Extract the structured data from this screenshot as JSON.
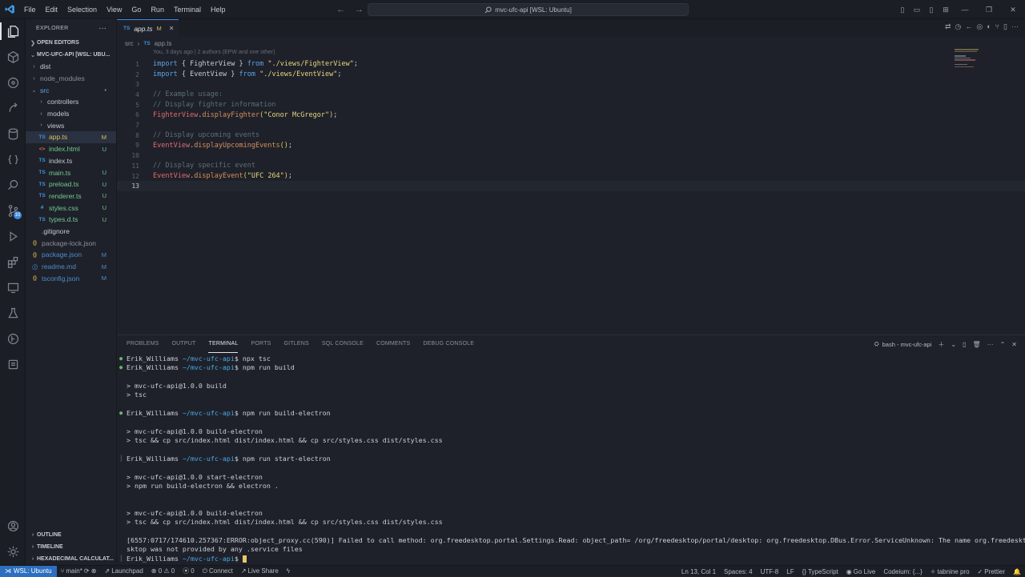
{
  "titlebar": {
    "menus": [
      "File",
      "Edit",
      "Selection",
      "View",
      "Go",
      "Run",
      "Terminal",
      "Help"
    ],
    "search_text": "mvc-ufc-api [WSL: Ubuntu]"
  },
  "sidebar": {
    "title": "EXPLORER",
    "open_editors": "OPEN EDITORS",
    "project": "MVC-UFC-API [WSL: UBU...",
    "items": [
      {
        "label": "dist",
        "type": "folder",
        "state": "closed",
        "depth": 1,
        "status": ""
      },
      {
        "label": "node_modules",
        "type": "folder",
        "state": "closed",
        "depth": 1,
        "status": "",
        "color": "grey"
      },
      {
        "label": "src",
        "type": "folder",
        "state": "open",
        "depth": 1,
        "status": "•",
        "color": "blue"
      },
      {
        "label": "controllers",
        "type": "folder",
        "state": "closed",
        "depth": 2,
        "status": ""
      },
      {
        "label": "models",
        "type": "folder",
        "state": "closed",
        "depth": 2,
        "status": ""
      },
      {
        "label": "views",
        "type": "folder",
        "state": "closed",
        "depth": 2,
        "status": ""
      },
      {
        "label": "app.ts",
        "type": "ts",
        "depth": 2,
        "status": "M",
        "color": "yellow",
        "selected": true
      },
      {
        "label": "index.html",
        "type": "html",
        "depth": 2,
        "status": "U",
        "color": "green"
      },
      {
        "label": "index.ts",
        "type": "ts",
        "depth": 2,
        "status": ""
      },
      {
        "label": "main.ts",
        "type": "ts",
        "depth": 2,
        "status": "U",
        "color": "green"
      },
      {
        "label": "preload.ts",
        "type": "ts",
        "depth": 2,
        "status": "U",
        "color": "green"
      },
      {
        "label": "renderer.ts",
        "type": "ts",
        "depth": 2,
        "status": "U",
        "color": "green"
      },
      {
        "label": "styles.css",
        "type": "css",
        "depth": 2,
        "status": "U",
        "color": "green"
      },
      {
        "label": "types.d.ts",
        "type": "ts",
        "depth": 2,
        "status": "U",
        "color": "green"
      },
      {
        "label": ".gitignore",
        "type": "none",
        "depth": 1,
        "status": ""
      },
      {
        "label": "package-lock.json",
        "type": "json",
        "depth": 1,
        "status": "",
        "color": "grey"
      },
      {
        "label": "package.json",
        "type": "json",
        "depth": 1,
        "status": "M",
        "color": "accentb"
      },
      {
        "label": "readme.md",
        "type": "md",
        "depth": 1,
        "status": "M",
        "color": "accentb"
      },
      {
        "label": "tsconfig.json",
        "type": "json",
        "depth": 1,
        "status": "M",
        "color": "accentb"
      }
    ],
    "bottom_sections": [
      "OUTLINE",
      "TIMELINE",
      "HEXADECIMAL CALCULAT..."
    ]
  },
  "editor": {
    "tab_label": "app.ts",
    "tab_status": "M",
    "breadcrumb": [
      "src",
      "app.ts"
    ],
    "codelens": "You, 3 days ago | 2 authors (EPW and one other)",
    "lines": [
      [
        [
          "kw",
          "import"
        ],
        [
          "pun",
          " { "
        ],
        [
          "idn",
          "FighterView"
        ],
        [
          "pun",
          " } "
        ],
        [
          "kw",
          "from"
        ],
        [
          "pun",
          " "
        ],
        [
          "str",
          "\"./views/FighterView\""
        ],
        [
          "pun",
          ";"
        ]
      ],
      [
        [
          "kw",
          "import"
        ],
        [
          "pun",
          " { "
        ],
        [
          "idn",
          "EventView"
        ],
        [
          "pun",
          " } "
        ],
        [
          "kw",
          "from"
        ],
        [
          "pun",
          " "
        ],
        [
          "str",
          "\"./views/EventView\""
        ],
        [
          "pun",
          ";"
        ]
      ],
      [],
      [
        [
          "cmt",
          "// Example usage:"
        ]
      ],
      [
        [
          "cmt",
          "// Display fighter information"
        ]
      ],
      [
        [
          "cls",
          "FighterView"
        ],
        [
          "pun",
          "."
        ],
        [
          "mth",
          "displayFighter"
        ],
        [
          "fn",
          "("
        ],
        [
          "str",
          "\"Conor McGregor\""
        ],
        [
          "fn",
          ")"
        ],
        [
          "pun",
          ";"
        ]
      ],
      [],
      [
        [
          "cmt",
          "// Display upcoming events"
        ]
      ],
      [
        [
          "cls",
          "EventView"
        ],
        [
          "pun",
          "."
        ],
        [
          "mth",
          "displayUpcomingEvents"
        ],
        [
          "fn",
          "()"
        ],
        [
          "pun",
          ";"
        ]
      ],
      [],
      [
        [
          "cmt",
          "// Display specific event"
        ]
      ],
      [
        [
          "cls",
          "EventView"
        ],
        [
          "pun",
          "."
        ],
        [
          "mth",
          "displayEvent"
        ],
        [
          "fn",
          "("
        ],
        [
          "str",
          "\"UFC 264\""
        ],
        [
          "fn",
          ")"
        ],
        [
          "pun",
          ";"
        ]
      ],
      []
    ]
  },
  "panel": {
    "tabs": [
      "PROBLEMS",
      "OUTPUT",
      "TERMINAL",
      "PORTS",
      "GITLENS",
      "SQL CONSOLE",
      "COMMENTS",
      "DEBUG CONSOLE"
    ],
    "active_tab": "TERMINAL",
    "terminal_name": "bash - mvc-ufc-api",
    "lines": [
      {
        "prompt": true,
        "dot": "green",
        "user": "Erik_Williams",
        "path": "~/mvc-ufc-api",
        "cmd": "$ npx tsc"
      },
      {
        "prompt": true,
        "dot": "green",
        "user": "Erik_Williams",
        "path": "~/mvc-ufc-api",
        "cmd": "$ npm run build"
      },
      {
        "text": ""
      },
      {
        "text": "> mvc-ufc-api@1.0.0 build"
      },
      {
        "text": "> tsc"
      },
      {
        "text": ""
      },
      {
        "prompt": true,
        "dot": "green",
        "user": "Erik_Williams",
        "path": "~/mvc-ufc-api",
        "cmd": "$ npm run build-electron"
      },
      {
        "text": ""
      },
      {
        "text": "> mvc-ufc-api@1.0.0 build-electron"
      },
      {
        "text": "> tsc && cp src/index.html dist/index.html && cp src/styles.css dist/styles.css"
      },
      {
        "text": ""
      },
      {
        "prompt": true,
        "dot": "none",
        "user": "Erik_Williams",
        "path": "~/mvc-ufc-api",
        "cmd": "$ npm run start-electron"
      },
      {
        "text": ""
      },
      {
        "text": "> mvc-ufc-api@1.0.0 start-electron"
      },
      {
        "text": "> npm run build-electron && electron ."
      },
      {
        "text": ""
      },
      {
        "text": ""
      },
      {
        "text": "> mvc-ufc-api@1.0.0 build-electron"
      },
      {
        "text": "> tsc && cp src/index.html dist/index.html && cp src/styles.css dist/styles.css"
      },
      {
        "text": ""
      },
      {
        "text": "[6557:0717/174610.257367:ERROR:object_proxy.cc(590)] Failed to call method: org.freedesktop.portal.Settings.Read: object_path= /org/freedesktop/portal/desktop: org.freedesktop.DBus.Error.ServiceUnknown: The name org.freedesktop.portal.De"
      },
      {
        "text": "sktop was not provided by any .service files"
      },
      {
        "prompt": true,
        "dot": "none",
        "user": "Erik_Williams",
        "path": "~/mvc-ufc-api",
        "cmd": "$ ",
        "cursor": true
      }
    ]
  },
  "statusbar": {
    "remote": "WSL: Ubuntu",
    "branch": "main*",
    "launchpad": "Launchpad",
    "problems": "⊗ 0 ⚠ 0",
    "ports": "0",
    "connect": "Connect",
    "liveshare": "Live Share",
    "position": "Ln 13, Col 1",
    "spaces": "Spaces: 4",
    "encoding": "UTF-8",
    "eol": "LF",
    "language": "TypeScript",
    "golive": "Go Live",
    "codeium": "Codeium: {...}",
    "tabnine": "tabnine pro",
    "prettier": "Prettier"
  },
  "activity_badge": "10"
}
